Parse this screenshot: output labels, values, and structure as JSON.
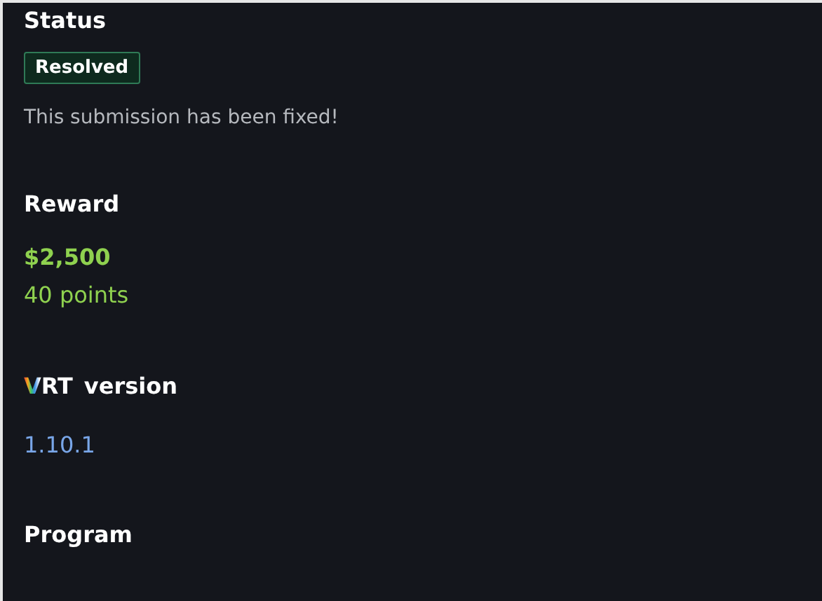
{
  "status": {
    "heading": "Status",
    "badge": "Resolved",
    "message": "This submission has been fixed!"
  },
  "reward": {
    "heading": "Reward",
    "amount": "$2,500",
    "points": "40 points"
  },
  "vrt": {
    "logo": "VRT",
    "heading": "version",
    "value": "1.10.1"
  },
  "program": {
    "heading": "Program"
  }
}
